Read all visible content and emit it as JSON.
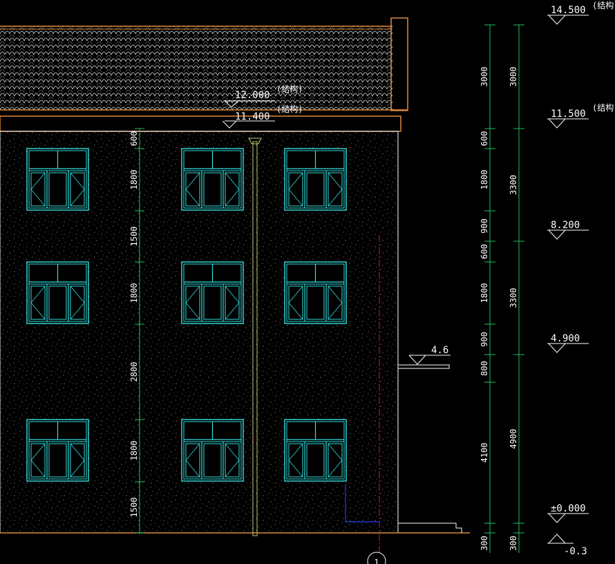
{
  "colors": {
    "background": "#000000",
    "wall_outline": "#ffffff",
    "roof": "#d9d9d9",
    "eave": "#e08a3c",
    "window": "#33e0e0",
    "dimension": "#20c060",
    "downpipe": "#c8c86a",
    "level": "#ffffff",
    "red_axis": "#e02020",
    "blue_line": "#2040ff"
  },
  "roof_notes": {
    "ridge_level": "12.000",
    "eave_level": "11.400",
    "struct_note_1": "(结构)",
    "struct_note_2": "(结构)"
  },
  "canopy_label": "4.6",
  "left_dimensions": [
    "600",
    "1800",
    "1500",
    "1800",
    "2800",
    "1800",
    "1500"
  ],
  "right_dimensions_inner": [
    "3000",
    "600",
    "1800",
    "900",
    "600",
    "1800",
    "900",
    "800",
    "4100",
    "300"
  ],
  "right_dimensions_outer": [
    "3000",
    "3300",
    "3300",
    "4900",
    "300"
  ],
  "levels": [
    "14.500",
    "11.500",
    "8.200",
    "4.900",
    "±0.000",
    "-0.3"
  ],
  "level_notes": [
    "(结构",
    "(结构"
  ],
  "axis_label": "1",
  "window_rows": 3,
  "window_cols": 3
}
